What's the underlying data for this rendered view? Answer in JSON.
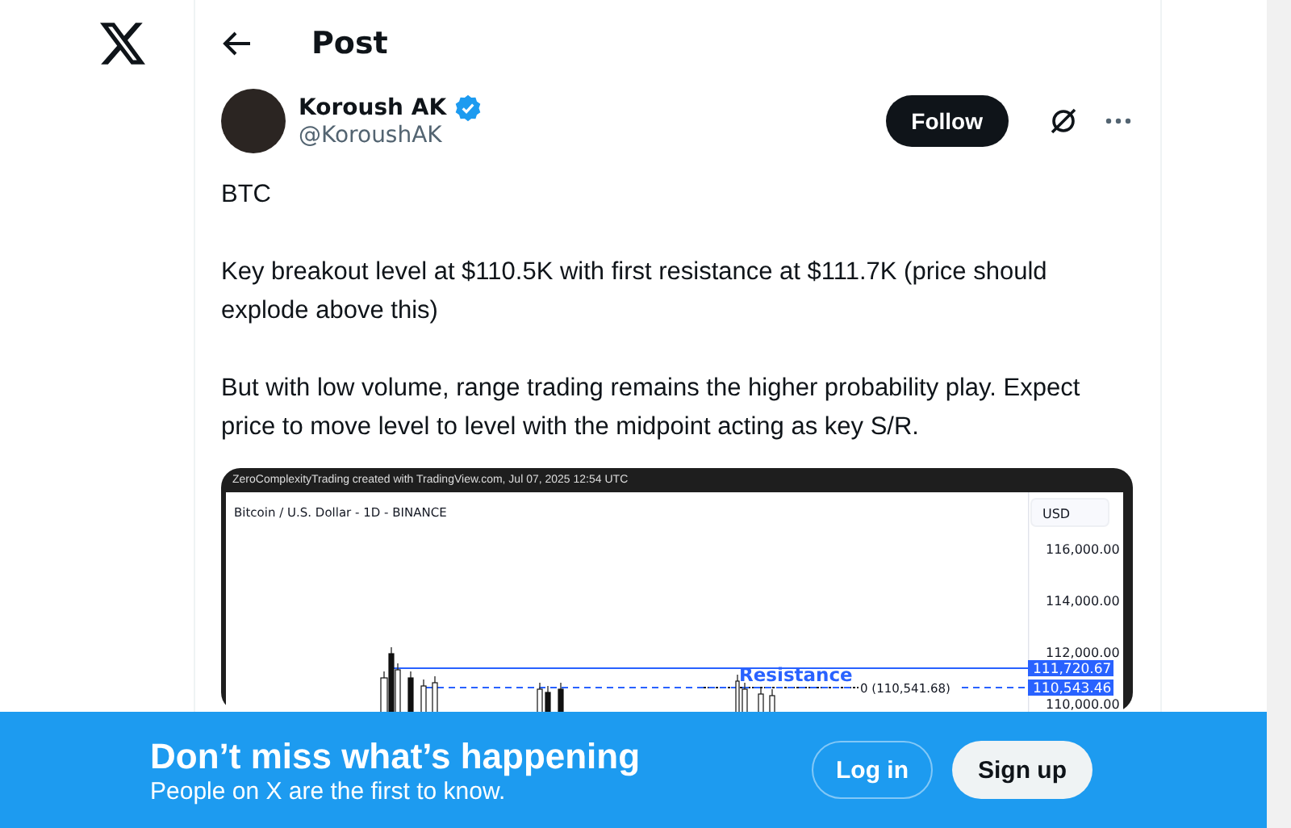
{
  "header": {
    "title": "Post"
  },
  "post": {
    "author": {
      "name": "Koroush AK",
      "handle": "@KoroushAK",
      "verified": true
    },
    "follow_button": "Follow",
    "paragraphs": [
      "BTC",
      "Key breakout level at $110.5K with first resistance at $111.7K (price should explode above this)",
      "But with low volume, range trading remains the higher probability play. Expect price to move level to level with the midpoint acting as key S/R."
    ],
    "image": {
      "caption": "ZeroComplexityTrading created with TradingView.com, Jul 07, 2025 12:54 UTC",
      "symbol": "Bitcoin / U.S. Dollar - 1D - BINANCE",
      "currency": "USD",
      "price_ticks": [
        "116,000.00",
        "114,000.00",
        "112,000.00",
        "110,000.00"
      ],
      "levels": [
        {
          "kind": "solid",
          "label": "111,720.67"
        },
        {
          "kind": "dashed",
          "label": "110,543.46"
        }
      ],
      "zone_label": "Resistance",
      "midpoint_label": "0 (110,541.68)"
    }
  },
  "banner": {
    "title": "Don’t miss what’s happening",
    "subtitle": "People on X are the first to know.",
    "login": "Log in",
    "signup": "Sign up"
  }
}
